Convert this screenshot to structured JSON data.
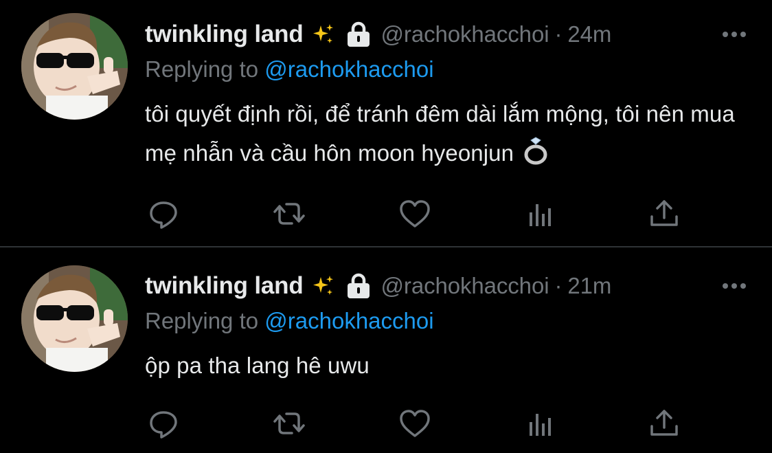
{
  "colors": {
    "background": "#000000",
    "text_primary": "#e7e9ea",
    "text_secondary": "#71767b",
    "link": "#1d9bf0",
    "divider": "#2f3336"
  },
  "icons": [
    "sparkles-icon",
    "lock-icon",
    "more-icon",
    "ring-icon",
    "reply-icon",
    "retweet-icon",
    "like-icon",
    "analytics-icon",
    "share-icon"
  ],
  "tweets": [
    {
      "display_name": "twinkling land",
      "handle": "@rachokhacchoi",
      "separator": "·",
      "time": "24m",
      "replying_prefix": "Replying to",
      "replying_to": "@rachokhacchoi",
      "text": "tôi quyết định rồi, để tránh đêm dài lắm mộng, tôi nên mua mẹ nhẫn và cầu hôn moon hyeonjun"
    },
    {
      "display_name": "twinkling land",
      "handle": "@rachokhacchoi",
      "separator": "·",
      "time": "21m",
      "replying_prefix": "Replying to",
      "replying_to": "@rachokhacchoi",
      "text": "ộp pa tha lang hê uwu"
    }
  ]
}
